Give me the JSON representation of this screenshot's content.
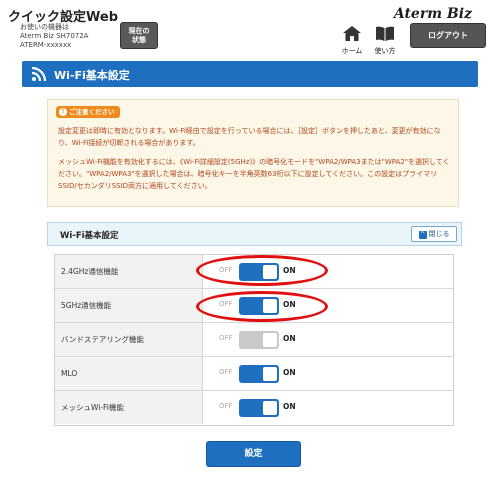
{
  "header": {
    "app_title": "クイック設定Web",
    "device_label": "お使いの機器は",
    "device_model": "Aterm Biz SH7072A",
    "device_id": "ATERM-xxxxxx",
    "status_button": "現在の\n状態",
    "brand": "Aterm Biz",
    "home_label": "ホーム",
    "manual_label": "使い方",
    "logout_label": "ログアウト"
  },
  "section": {
    "title": "Wi-Fi基本設定"
  },
  "caution": {
    "badge": "ご注意ください",
    "paragraph_1": "設定変更は即時に有効となります。Wi-Fi経由で設定を行っている場合には、［設定］ボタンを押したあと、変更が有効になり、Wi-Fi接続が切断される場合があります。",
    "paragraph_2": "メッシュWi-Fi機能を有効化するには、《Wi-Fi詳細設定(5GHz)》の暗号化モードを\"WPA2/WPA3または\"WPA2\"を選択してください。\"WPA2/WPA3\"を選択した場合は、暗号化キーを半角英数63桁以下に設定してください。この設定はプライマリSSID/セカンダリSSID両方に適用してください。"
  },
  "panel": {
    "title": "Wi-Fi基本設定",
    "collapse_label": "閉じる",
    "rows": [
      {
        "label": "2.4GHz通信機能",
        "off": "OFF",
        "on": "ON",
        "state": "on",
        "disabled": false
      },
      {
        "label": "5GHz通信機能",
        "off": "OFF",
        "on": "ON",
        "state": "on",
        "disabled": false
      },
      {
        "label": "バンドステアリング機能",
        "off": "OFF",
        "on": "ON",
        "state": "on",
        "disabled": true
      },
      {
        "label": "MLO",
        "off": "OFF",
        "on": "ON",
        "state": "on",
        "disabled": false
      },
      {
        "label": "メッシュWi-Fi機能",
        "off": "OFF",
        "on": "ON",
        "state": "on",
        "disabled": false
      }
    ]
  },
  "submit_label": "設定",
  "colors": {
    "accent": "#1e6fbf",
    "caution_text": "#b3461f",
    "highlight_ring": "#e01010"
  }
}
